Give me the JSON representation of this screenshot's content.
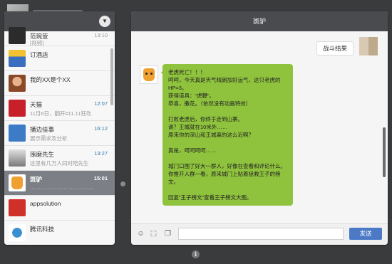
{
  "header": {
    "menu_icon": "▼"
  },
  "conversations": [
    {
      "name": "范琬萱",
      "sub": "[视频]",
      "time": "13:10",
      "avatar_color": "#2b2b2b"
    },
    {
      "name": "订酒店",
      "sub": "",
      "time": "",
      "avatar_color": "#3a6fc0"
    },
    {
      "name": "我的XX是个XX",
      "sub": "",
      "time": "",
      "avatar_color": "#c0703a"
    },
    {
      "name": "天猫",
      "sub": "11月6日，翻开#11.11狂欢",
      "time": "12:07",
      "avatar_color": "#c8202a"
    },
    {
      "name": "播边佳事",
      "sub": "展示需求及分析",
      "time": "16:12",
      "avatar_color": "#3c7bc6"
    },
    {
      "name": "琢磨先生",
      "sub": "这里有几万人同时陪先生",
      "time": "13:27",
      "avatar_color": "#7a7a7a"
    },
    {
      "name": "斑驴",
      "sub": "………………………………",
      "time": "15:01",
      "avatar_color": "#f0a030"
    },
    {
      "name": "appsolution",
      "sub": "",
      "time": "",
      "avatar_color": "#d0302a"
    },
    {
      "name": "腾讯科技",
      "sub": "",
      "time": "",
      "avatar_color": "#3a8fd0"
    }
  ],
  "chat": {
    "title": "斑驴",
    "right_message": "战斗结果",
    "left_message": [
      "老虎死亡！！！",
      "呵呵，今天真是天气晴朗加好运气，这只老虎的HP=3。",
      "获得道具：“虎鞭”。",
      "恭喜，撒花。（依然没有动画特效）",
      "",
      "打败老虎后，你终于走到山寨。",
      "诶？王城就在10米外……",
      "原来你的深山和王城离的这么近啊？",
      "",
      "真是，呵呵呵呵……",
      "",
      "城门口围了好大一群人，好像在查看和评论什么。你推开人群一看，原来城门上贴着拯救王子的榜文。",
      "",
      "回复“王子榜文”查看王子榜文大图。"
    ]
  },
  "input": {
    "placeholder": "",
    "send_label": "发送",
    "emoji_icon": "☺",
    "screenshot_icon": "⬚",
    "file_icon": "❐"
  },
  "footer": {
    "info_icon": "i"
  }
}
